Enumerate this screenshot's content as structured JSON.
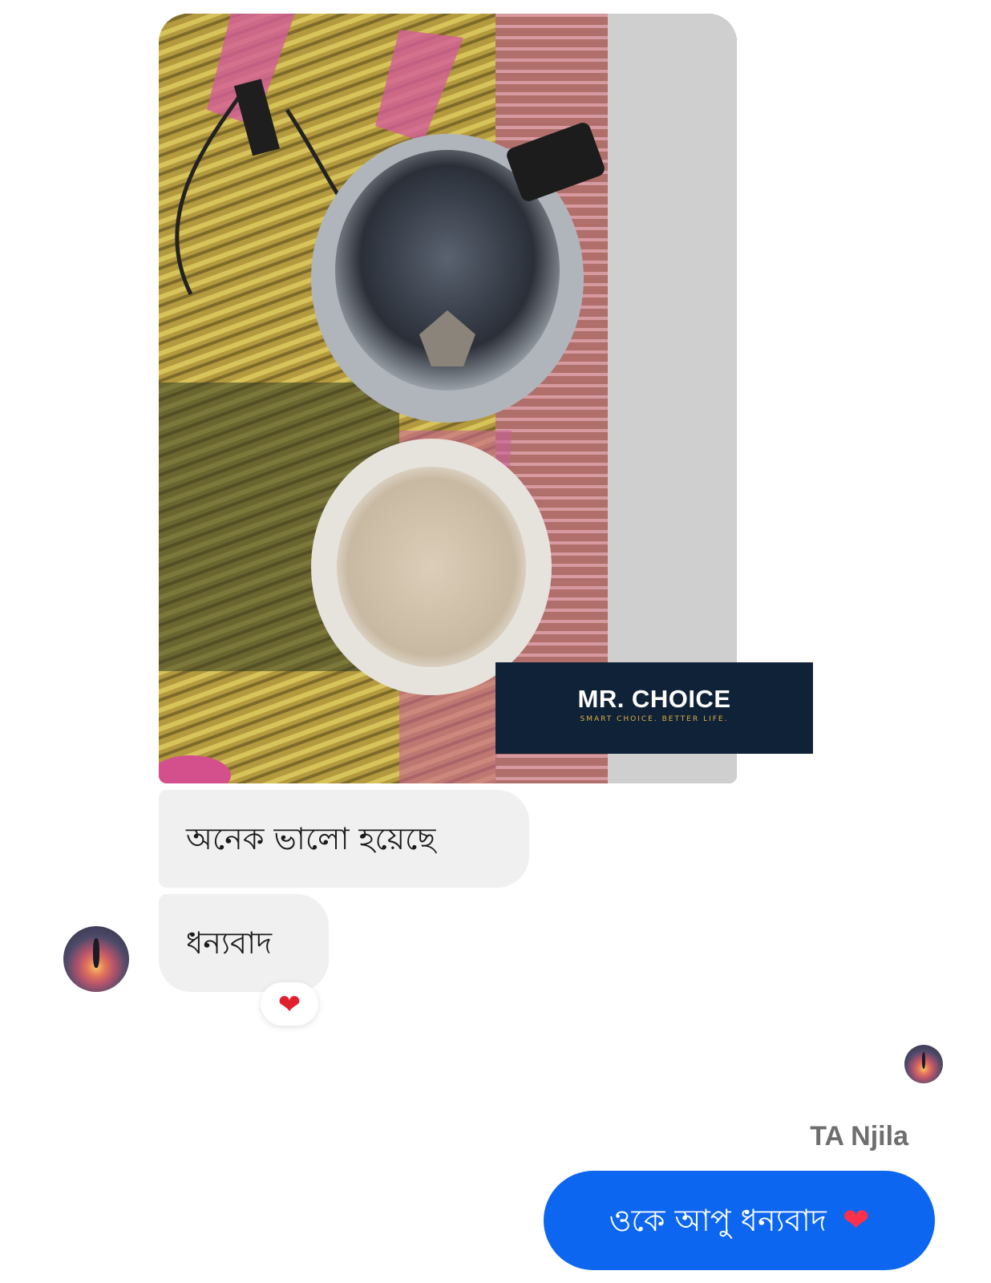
{
  "watermark": {
    "brand": "MR. CHOICE",
    "tagline": "SMART CHOICE. BETTER LIFE."
  },
  "messages": [
    {
      "direction": "incoming",
      "text": "অনেক ভালো হয়েছে"
    },
    {
      "direction": "incoming",
      "text": "ধন্যবাদ",
      "reaction": "❤"
    }
  ],
  "reply": {
    "sender_name": "TA Njila",
    "text": "ওকে আপু ধন্যবাদ",
    "emoji": "❤"
  },
  "colors": {
    "incoming_bubble": "#f0f0f0",
    "outgoing_bubble": "#0c66f0",
    "watermark_bg": "#0f2238",
    "watermark_tagline": "#e0b13f"
  }
}
